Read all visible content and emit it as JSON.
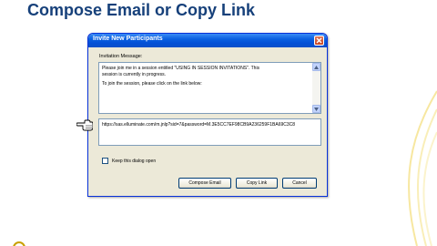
{
  "slide": {
    "title": "Compose Email or Copy Link",
    "accent_color": "#16407a",
    "deco_color": "#f7e7a0"
  },
  "dialog": {
    "title": "Invite New Participants",
    "message_label": "Invitation Message:",
    "message_lines": [
      "Please join me in a session entitled \"USING IN SESSION INVITATIONS\". This",
      "session is currently in progress.",
      "To join the session, please click on the link below:"
    ],
    "link_text": "https://sas.elluminate.com/m.jnlp?sid=7&password=M.3E5CC7EF98CB9A236259F1BA69C3C8",
    "keep_open_label": "Keep this dialog open",
    "keep_open_checked": false,
    "buttons": {
      "compose": "Compose Email",
      "copy": "Copy Link",
      "cancel": "Cancel"
    },
    "icons": {
      "close": "close-icon",
      "scroll_up": "scroll-up-arrow-icon",
      "scroll_down": "scroll-down-arrow-icon",
      "pointer": "pointing-hand-icon"
    }
  }
}
